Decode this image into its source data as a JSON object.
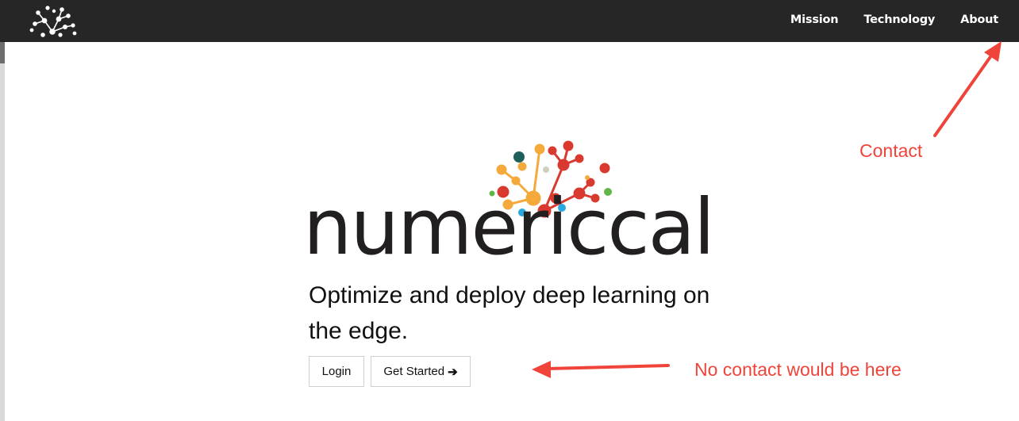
{
  "navbar": {
    "logo_icon": "tree-network-logo-icon",
    "links": [
      "Mission",
      "Technology",
      "About"
    ]
  },
  "hero": {
    "brand": "numericcal",
    "tagline": "Optimize and deploy deep learning on the edge.",
    "login_label": "Login",
    "get_started_label": "Get Started",
    "get_started_icon": "arrow-right-icon"
  },
  "annotations": {
    "contact": "Contact",
    "no_contact": "No contact would be here",
    "color": "#f0443a"
  },
  "colors": {
    "navbar_bg": "#262626",
    "brand_text": "#221f20",
    "logo_orange": "#f5a93a",
    "logo_red": "#d93a2f",
    "logo_teal": "#1f5f5b",
    "logo_blue": "#2aa7df",
    "logo_green": "#5fb646"
  }
}
